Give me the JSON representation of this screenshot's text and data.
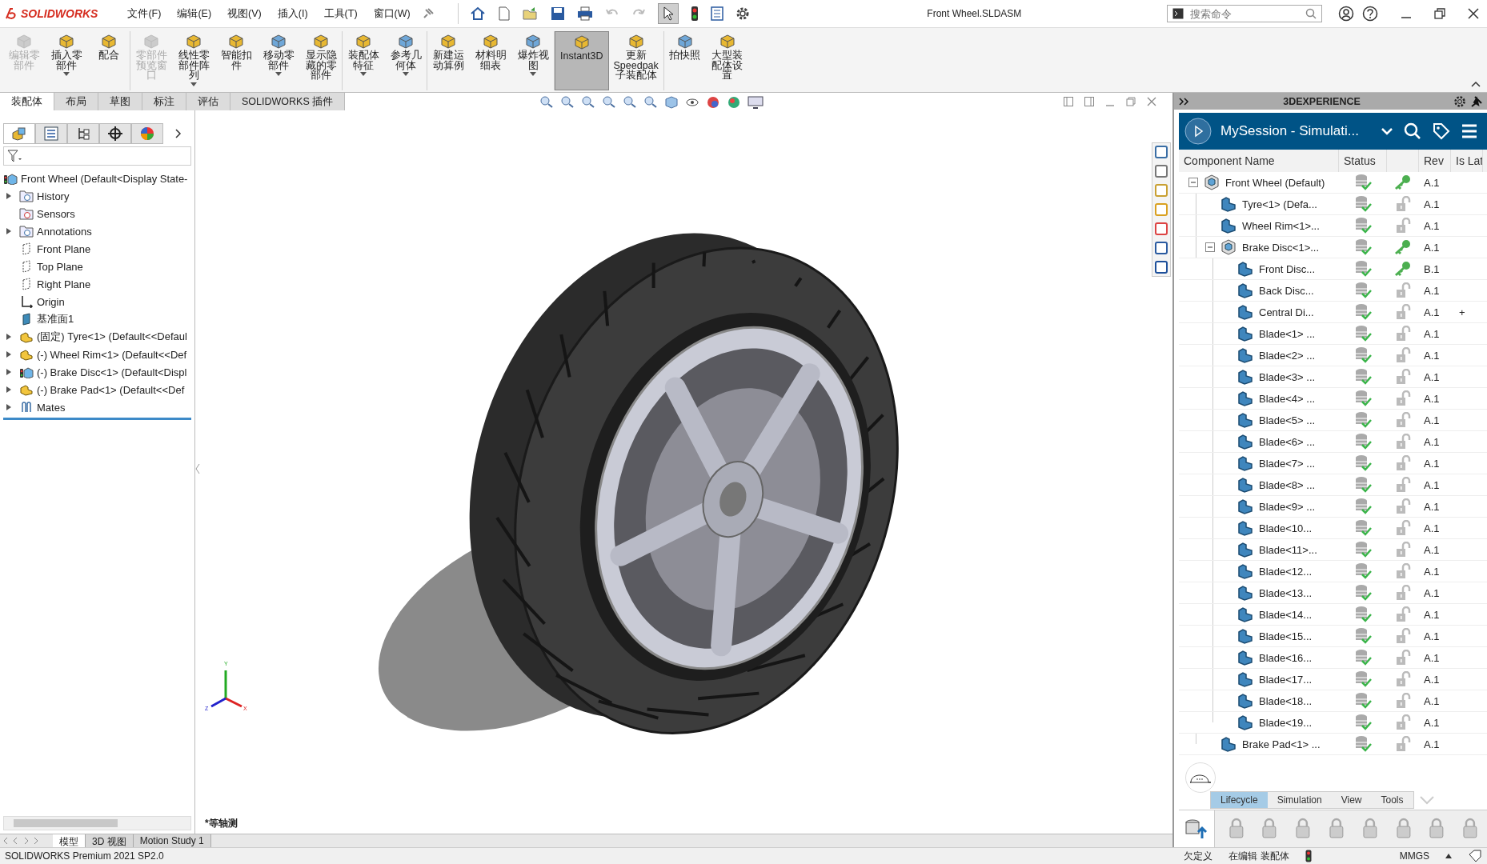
{
  "title_bar": {
    "app_name": "SOLIDWORKS",
    "menus": [
      "文件(F)",
      "编辑(E)",
      "视图(V)",
      "插入(I)",
      "工具(T)",
      "窗口(W)"
    ],
    "document_title": "Front Wheel.SLDASM",
    "search": {
      "placeholder": "搜索命令"
    }
  },
  "ribbon": [
    {
      "label": "编辑零部件",
      "disabled": true,
      "dropdown": false,
      "selected": false
    },
    {
      "label": "插入零部件",
      "disabled": false,
      "dropdown": true,
      "selected": false
    },
    {
      "label": "配合",
      "disabled": false,
      "dropdown": false,
      "selected": false
    },
    {
      "label": "零部件预览窗口",
      "disabled": true,
      "dropdown": false,
      "selected": false
    },
    {
      "label": "线性零部件阵列",
      "disabled": false,
      "dropdown": true,
      "selected": false
    },
    {
      "label": "智能扣件",
      "disabled": false,
      "dropdown": false,
      "selected": false
    },
    {
      "label": "移动零部件",
      "disabled": false,
      "dropdown": true,
      "selected": false
    },
    {
      "label": "显示隐藏的零部件",
      "disabled": false,
      "dropdown": false,
      "selected": false
    },
    {
      "label": "装配体特征",
      "disabled": false,
      "dropdown": true,
      "selected": false
    },
    {
      "label": "参考几何体",
      "disabled": false,
      "dropdown": true,
      "selected": false
    },
    {
      "label": "新建运动算例",
      "disabled": false,
      "dropdown": false,
      "selected": false
    },
    {
      "label": "材料明细表",
      "disabled": false,
      "dropdown": false,
      "selected": false
    },
    {
      "label": "爆炸视图",
      "disabled": false,
      "dropdown": true,
      "selected": false
    },
    {
      "label": "Instant3D",
      "disabled": false,
      "dropdown": false,
      "selected": true
    },
    {
      "label": "更新Speedpak子装配体",
      "disabled": false,
      "dropdown": false,
      "selected": false
    },
    {
      "label": "拍快照",
      "disabled": false,
      "dropdown": false,
      "selected": false
    },
    {
      "label": "大型装配体设置",
      "disabled": false,
      "dropdown": false,
      "selected": false
    }
  ],
  "command_tabs": [
    {
      "label": "装配体",
      "selected": true
    },
    {
      "label": "布局",
      "selected": false
    },
    {
      "label": "草图",
      "selected": false
    },
    {
      "label": "标注",
      "selected": false
    },
    {
      "label": "评估",
      "selected": false
    },
    {
      "label": "SOLIDWORKS 插件",
      "selected": false
    }
  ],
  "feature_tree": {
    "root": {
      "label": "Front Wheel  (Default<Display State-",
      "kind": "assembly"
    },
    "items": [
      {
        "label": "History",
        "kind": "history",
        "collapsible": true
      },
      {
        "label": "Sensors",
        "kind": "sensor",
        "collapsible": false
      },
      {
        "label": "Annotations",
        "kind": "annotation",
        "collapsible": true
      },
      {
        "label": "Front Plane",
        "kind": "plane",
        "collapsible": false
      },
      {
        "label": "Top Plane",
        "kind": "plane",
        "collapsible": false
      },
      {
        "label": "Right Plane",
        "kind": "plane",
        "collapsible": false
      },
      {
        "label": "Origin",
        "kind": "origin",
        "collapsible": false
      },
      {
        "label": "基准面1",
        "kind": "datum",
        "collapsible": false
      },
      {
        "label": "(固定) Tyre<1> (Default<<Defaul",
        "kind": "part",
        "collapsible": true
      },
      {
        "label": "(-) Wheel Rim<1> (Default<<Def",
        "kind": "part",
        "collapsible": true
      },
      {
        "label": "(-) Brake Disc<1> (Default<Displ",
        "kind": "assembly",
        "collapsible": true
      },
      {
        "label": "(-) Brake Pad<1> (Default<<Def",
        "kind": "part",
        "collapsible": true
      },
      {
        "label": "Mates",
        "kind": "mates",
        "collapsible": true
      }
    ]
  },
  "viewport": {
    "view_label": "*等轴测",
    "triad": [
      "Y",
      "Z",
      "X"
    ]
  },
  "bottom_tabs": [
    {
      "label": "模型",
      "selected": true
    },
    {
      "label": "3D 视图",
      "selected": false
    },
    {
      "label": "Motion Study 1",
      "selected": false
    }
  ],
  "status_bar": {
    "product": "SOLIDWORKS Premium 2021 SP2.0",
    "state": "欠定义",
    "mode": "在编辑 装配体",
    "units": "MMGS"
  },
  "experience_panel": {
    "title": "3DEXPERIENCE",
    "session": "MySession - Simulati...",
    "columns": [
      "Component Name",
      "Status",
      "Rev",
      "Is Lat"
    ],
    "components": [
      {
        "name": "Front Wheel (Default)",
        "kind": "assembly",
        "reserved": true,
        "rev": "A.1",
        "expanded": true,
        "children": [
          {
            "name": "Tyre<1> (Defa...",
            "kind": "part",
            "reserved": false,
            "rev": "A.1"
          },
          {
            "name": "Wheel Rim<1>...",
            "kind": "part",
            "reserved": false,
            "rev": "A.1"
          },
          {
            "name": "Brake Disc<1>...",
            "kind": "assembly",
            "reserved": true,
            "rev": "A.1",
            "expanded": true,
            "children": [
              {
                "name": "Front Disc...",
                "kind": "part",
                "reserved": true,
                "rev": "B.1"
              },
              {
                "name": "Back Disc...",
                "kind": "part",
                "reserved": false,
                "rev": "A.1"
              },
              {
                "name": "Central Di...",
                "kind": "part",
                "reserved": false,
                "rev": "A.1",
                "is_latest": "+"
              },
              {
                "name": "Blade<1> ...",
                "kind": "part",
                "reserved": false,
                "rev": "A.1"
              },
              {
                "name": "Blade<2> ...",
                "kind": "part",
                "reserved": false,
                "rev": "A.1"
              },
              {
                "name": "Blade<3> ...",
                "kind": "part",
                "reserved": false,
                "rev": "A.1"
              },
              {
                "name": "Blade<4> ...",
                "kind": "part",
                "reserved": false,
                "rev": "A.1"
              },
              {
                "name": "Blade<5> ...",
                "kind": "part",
                "reserved": false,
                "rev": "A.1"
              },
              {
                "name": "Blade<6> ...",
                "kind": "part",
                "reserved": false,
                "rev": "A.1"
              },
              {
                "name": "Blade<7> ...",
                "kind": "part",
                "reserved": false,
                "rev": "A.1"
              },
              {
                "name": "Blade<8> ...",
                "kind": "part",
                "reserved": false,
                "rev": "A.1"
              },
              {
                "name": "Blade<9> ...",
                "kind": "part",
                "reserved": false,
                "rev": "A.1"
              },
              {
                "name": "Blade<10...",
                "kind": "part",
                "reserved": false,
                "rev": "A.1"
              },
              {
                "name": "Blade<11>...",
                "kind": "part",
                "reserved": false,
                "rev": "A.1"
              },
              {
                "name": "Blade<12...",
                "kind": "part",
                "reserved": false,
                "rev": "A.1"
              },
              {
                "name": "Blade<13...",
                "kind": "part",
                "reserved": false,
                "rev": "A.1"
              },
              {
                "name": "Blade<14...",
                "kind": "part",
                "reserved": false,
                "rev": "A.1"
              },
              {
                "name": "Blade<15...",
                "kind": "part",
                "reserved": false,
                "rev": "A.1"
              },
              {
                "name": "Blade<16...",
                "kind": "part",
                "reserved": false,
                "rev": "A.1"
              },
              {
                "name": "Blade<17...",
                "kind": "part",
                "reserved": false,
                "rev": "A.1"
              },
              {
                "name": "Blade<18...",
                "kind": "part",
                "reserved": false,
                "rev": "A.1"
              },
              {
                "name": "Blade<19...",
                "kind": "part",
                "reserved": false,
                "rev": "A.1"
              }
            ]
          },
          {
            "name": "Brake Pad<1> ...",
            "kind": "part",
            "reserved": false,
            "rev": "A.1"
          }
        ]
      }
    ],
    "tabs": [
      {
        "label": "Lifecycle",
        "selected": true
      },
      {
        "label": "Simulation",
        "selected": false
      },
      {
        "label": "View",
        "selected": false
      },
      {
        "label": "Tools",
        "selected": false
      }
    ]
  }
}
